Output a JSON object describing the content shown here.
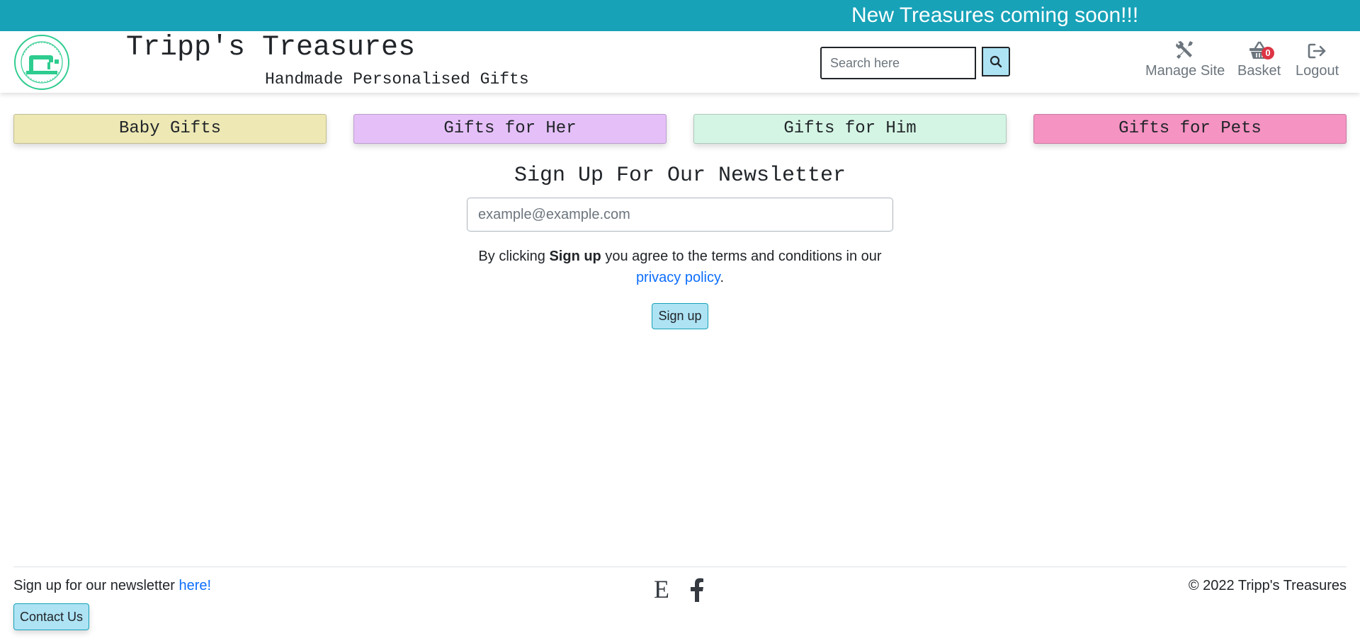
{
  "banner": {
    "text": "New Treasures coming soon!!!"
  },
  "header": {
    "logo_text": "Tripp's Treasures",
    "title": "Tripp's Treasures",
    "tagline": "Handmade Personalised Gifts",
    "search": {
      "placeholder": "Search here"
    },
    "nav": {
      "manage": "Manage Site",
      "basket": "Basket",
      "basket_count": "0",
      "logout": "Logout"
    }
  },
  "categories": [
    {
      "label": "Baby Gifts",
      "color": "#ede8b4"
    },
    {
      "label": "Gifts for Her",
      "color": "#e5c0f8"
    },
    {
      "label": "Gifts for Him",
      "color": "#d4f5e4"
    },
    {
      "label": "Gifts for Pets",
      "color": "#f593c2"
    }
  ],
  "newsletter": {
    "title": "Sign Up For Our Newsletter",
    "email_placeholder": "example@example.com",
    "terms_prefix": "By clicking ",
    "terms_bold": "Sign up",
    "terms_middle": " you agree to the terms and conditions in our",
    "privacy_link": "privacy policy",
    "terms_suffix": ".",
    "button": "Sign up"
  },
  "footer": {
    "newsletter_text": "Sign up for our newsletter ",
    "newsletter_link": "here!",
    "contact_button": "Contact Us",
    "etsy_icon": "E",
    "copyright": "© 2022 Tripp's Treasures"
  },
  "colors": {
    "banner": "#17a2b8",
    "button_bg": "#aee3f4",
    "badge": "#dc3545",
    "link": "#0d6efd",
    "logo_green": "#2ecc8f"
  }
}
